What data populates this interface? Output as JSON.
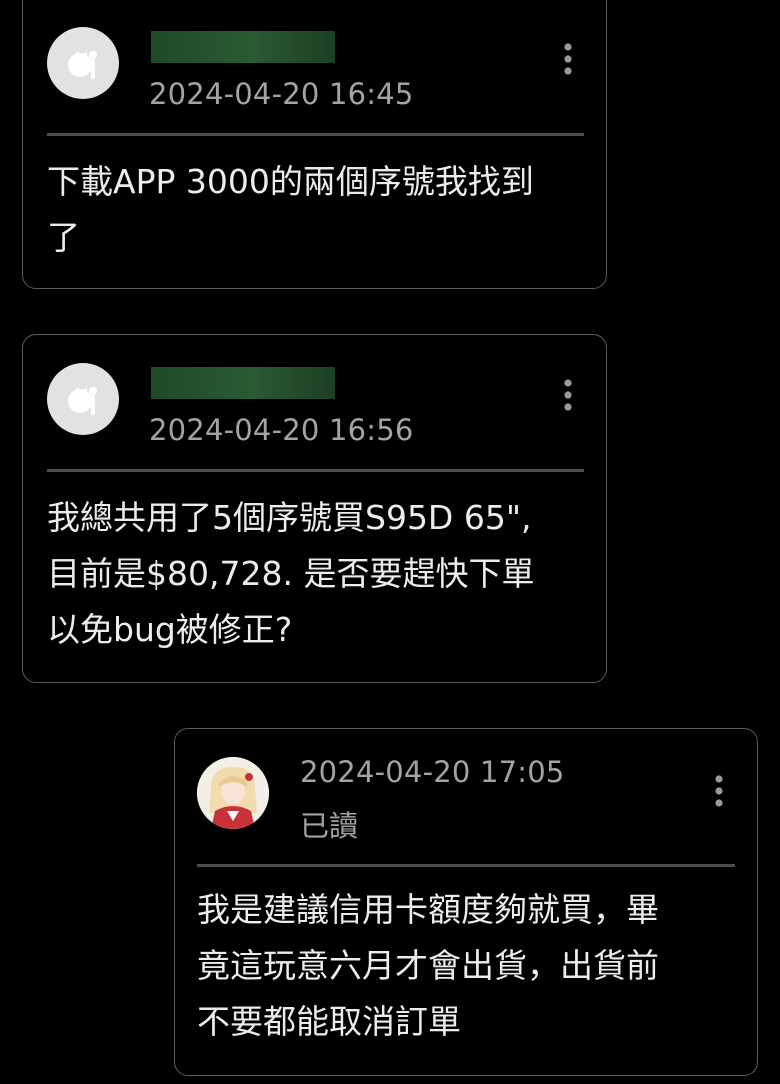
{
  "colors": {
    "background": "#000000",
    "card_border": "#5a5a5a",
    "text_primary": "#ececec",
    "text_secondary": "#a3a3a3",
    "divider": "#4c4c4c",
    "redaction": "#2a5a34"
  },
  "messages": [
    {
      "avatar": "default-avatar-icon",
      "sender_redacted": true,
      "timestamp": "2024-04-20 16:45",
      "lines": [
        "下載APP 3000的兩個序號我找到",
        "了"
      ]
    },
    {
      "avatar": "default-avatar-icon",
      "sender_redacted": true,
      "timestamp": "2024-04-20 16:56",
      "lines": [
        "我總共用了5個序號買S95D 65\",",
        "目前是$80,728. 是否要趕快下單",
        "以免bug被修正?"
      ]
    },
    {
      "avatar": "user-photo-avatar",
      "sender_redacted": false,
      "timestamp": "2024-04-20 17:05",
      "read_status": "已讀",
      "lines": [
        "我是建議信用卡額度夠就買，畢",
        "竟這玩意六月才會出貨，出貨前",
        "不要都能取消訂單"
      ]
    }
  ]
}
